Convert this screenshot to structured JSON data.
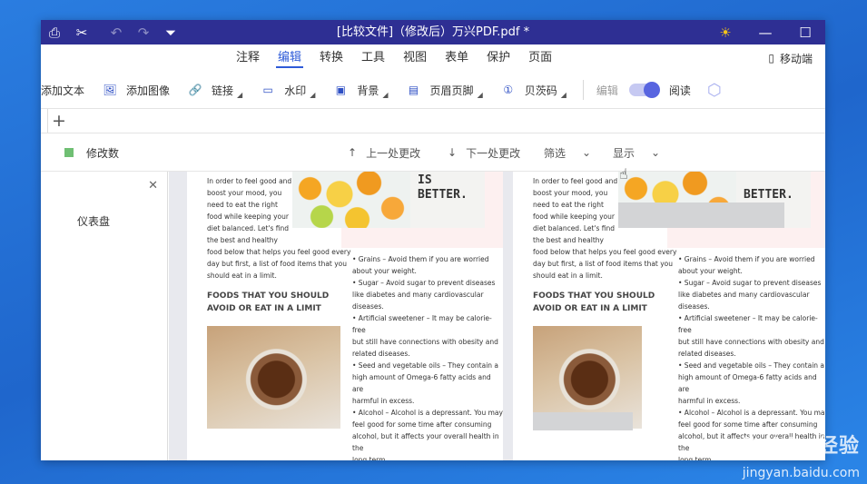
{
  "window": {
    "title": "[比较文件]（修改后）万兴PDF.pdf *"
  },
  "titlebar": {
    "print_icon": "print-icon",
    "cut_icon": "scissors-icon",
    "undo_icon": "undo-icon",
    "redo_icon": "redo-icon",
    "dropdown_icon": "dropdown-icon",
    "theme_icon": "sun-icon",
    "minimize": "—",
    "maximize": "☐"
  },
  "menus": [
    "注释",
    "编辑",
    "转换",
    "工具",
    "视图",
    "表单",
    "保护",
    "页面"
  ],
  "active_menu": "编辑",
  "mobile_label": "移动端",
  "toolbar": {
    "add_text": "添加文本",
    "add_image": "添加图像",
    "link": "链接",
    "watermark": "水印",
    "background": "背景",
    "header_footer": "页眉页脚",
    "bates": "贝茨码",
    "edit": "编辑",
    "read": "阅读"
  },
  "compare": {
    "legend_color": "#6fbf73",
    "legend_label": "修改数",
    "prev_change": "上一处更改",
    "next_change": "下一处更改",
    "filter": "筛选",
    "display": "显示"
  },
  "sidebar": {
    "item": "仪表盘"
  },
  "page": {
    "intro": [
      "In order to feel good and",
      "boost your mood, you",
      "need to eat the right",
      "food while keeping your",
      "diet balanced. Let's find",
      "the best and healthy",
      "food below that helps you feel good every",
      "day but first, a list of food items that you",
      "should eat in a limit."
    ],
    "better_text": [
      "IS",
      "BETTER."
    ],
    "heading": [
      "FOODS THAT YOU SHOULD",
      "AVOID OR EAT IN A LIMIT"
    ],
    "bullets": [
      "• Grains – Avoid them if you are worried",
      "about your weight.",
      "• Sugar – Avoid sugar to prevent diseases",
      "like diabetes and many cardiovascular",
      "diseases.",
      "• Artificial sweetener – It may be calorie-free",
      "but still have connections with obesity and",
      "related diseases.",
      "• Seed and vegetable oils – They contain a",
      "high amount of Omega-6 fatty acids and are",
      "harmful in excess.",
      "• Alcohol – Alcohol is a depressant. You may",
      "feel good for some time after consuming",
      "alcohol, but it affects your overall health in the",
      "long term."
    ]
  },
  "watermark": {
    "main": "Baidu 经验",
    "sub": "jingyan.baidu.com"
  }
}
